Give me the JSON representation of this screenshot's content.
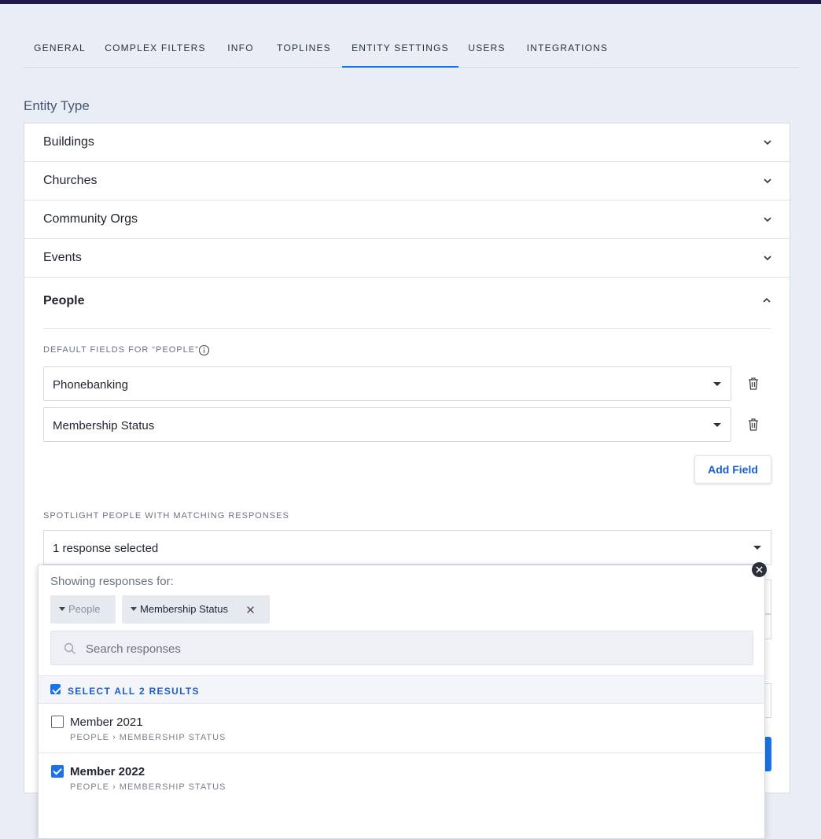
{
  "tabs": [
    {
      "label": "GENERAL"
    },
    {
      "label": "COMPLEX FILTERS"
    },
    {
      "label": "INFO"
    },
    {
      "label": "TOPLINES"
    },
    {
      "label": "ENTITY SETTINGS",
      "active": true
    },
    {
      "label": "USERS"
    },
    {
      "label": "INTEGRATIONS"
    }
  ],
  "section_title": "Entity Type",
  "entity_types": [
    {
      "label": "Buildings",
      "expanded": false
    },
    {
      "label": "Churches",
      "expanded": false
    },
    {
      "label": "Community Orgs",
      "expanded": false
    },
    {
      "label": "Events",
      "expanded": false
    },
    {
      "label": "People",
      "expanded": true
    }
  ],
  "people": {
    "default_fields_label": "DEFAULT FIELDS FOR “PEOPLE”",
    "fields": [
      "Phonebanking",
      "Membership Status"
    ],
    "add_field_label": "Add Field",
    "spotlight_label": "SPOTLIGHT PEOPLE WITH MATCHING RESPONSES",
    "spotlight_value": "1 response selected"
  },
  "popup": {
    "showing_label": "Showing responses for:",
    "chips": [
      "People",
      "Membership Status"
    ],
    "search_placeholder": "Search responses",
    "select_all_label": "SELECT ALL 2 RESULTS",
    "select_all_checked": true,
    "results": [
      {
        "title": "Member 2021",
        "path": "PEOPLE › MEMBERSHIP STATUS",
        "checked": false
      },
      {
        "title": "Member 2022",
        "path": "PEOPLE › MEMBERSHIP STATUS",
        "checked": true
      }
    ]
  },
  "colors": {
    "accent": "#1a73e8",
    "topbar": "#1f1a4a",
    "background": "#e9edf5"
  }
}
